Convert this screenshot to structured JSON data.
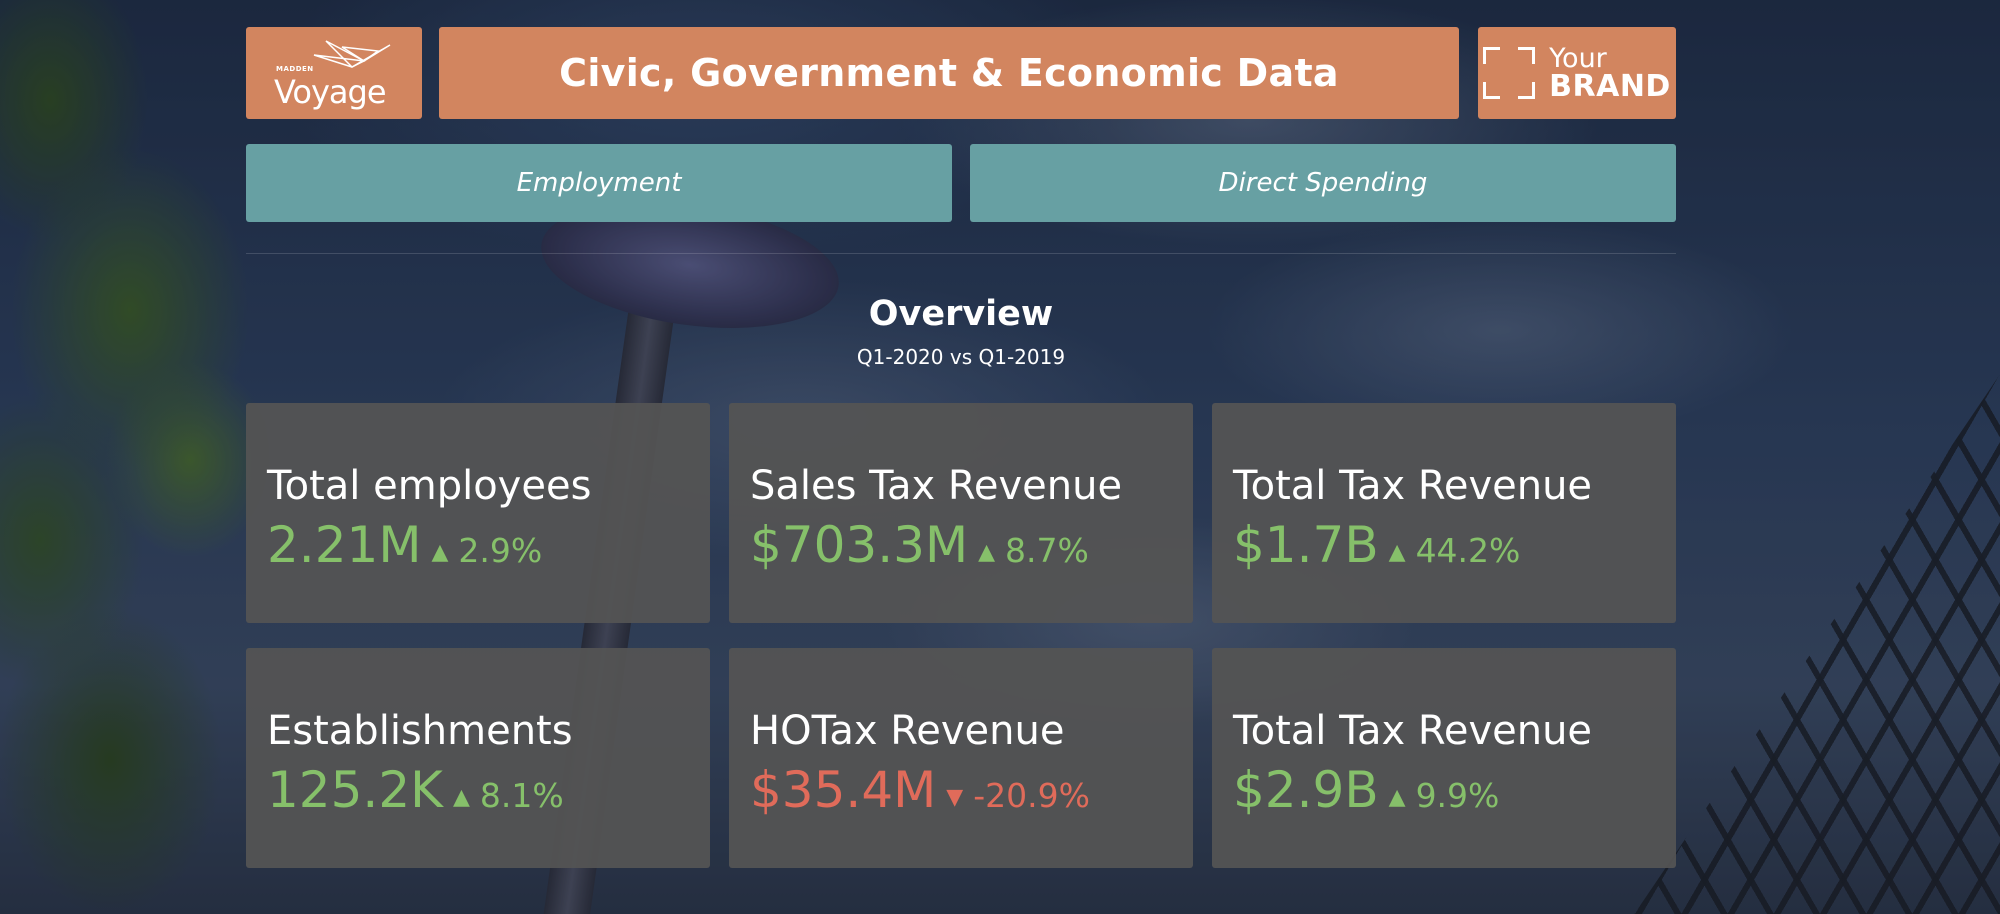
{
  "header": {
    "title": "Civic, Government & Economic Data",
    "logo_left": {
      "small_text": "MADDEN",
      "main_text": "Voyage"
    },
    "logo_right": {
      "line1": "Your",
      "line2": "BRAND"
    }
  },
  "tabs": [
    {
      "label": "Employment"
    },
    {
      "label": "Direct Spending"
    }
  ],
  "overview": {
    "title": "Overview",
    "subtitle": "Q1-2020 vs Q1-2019"
  },
  "cards": [
    {
      "label": "Total employees",
      "value": "2.21M",
      "change": "2.9%",
      "direction": "up"
    },
    {
      "label": "Sales Tax Revenue",
      "value": "$703.3M",
      "change": "8.7%",
      "direction": "up"
    },
    {
      "label": "Total Tax Revenue",
      "value": "$1.7B",
      "change": "44.2%",
      "direction": "up"
    },
    {
      "label": "Establishments",
      "value": "125.2K",
      "change": "8.1%",
      "direction": "up"
    },
    {
      "label": "HOTax Revenue",
      "value": "$35.4M",
      "change": "-20.9%",
      "direction": "down"
    },
    {
      "label": "Total Tax Revenue",
      "value": "$2.9B",
      "change": "9.9%",
      "direction": "up"
    }
  ],
  "colors": {
    "header_orange": "#d2855f",
    "tab_teal": "#67a0a3",
    "card_gray": "#545454",
    "positive_green": "#86c06a",
    "negative_red": "#e06b5a"
  },
  "icons": {
    "up": "▲",
    "down": "▼"
  }
}
